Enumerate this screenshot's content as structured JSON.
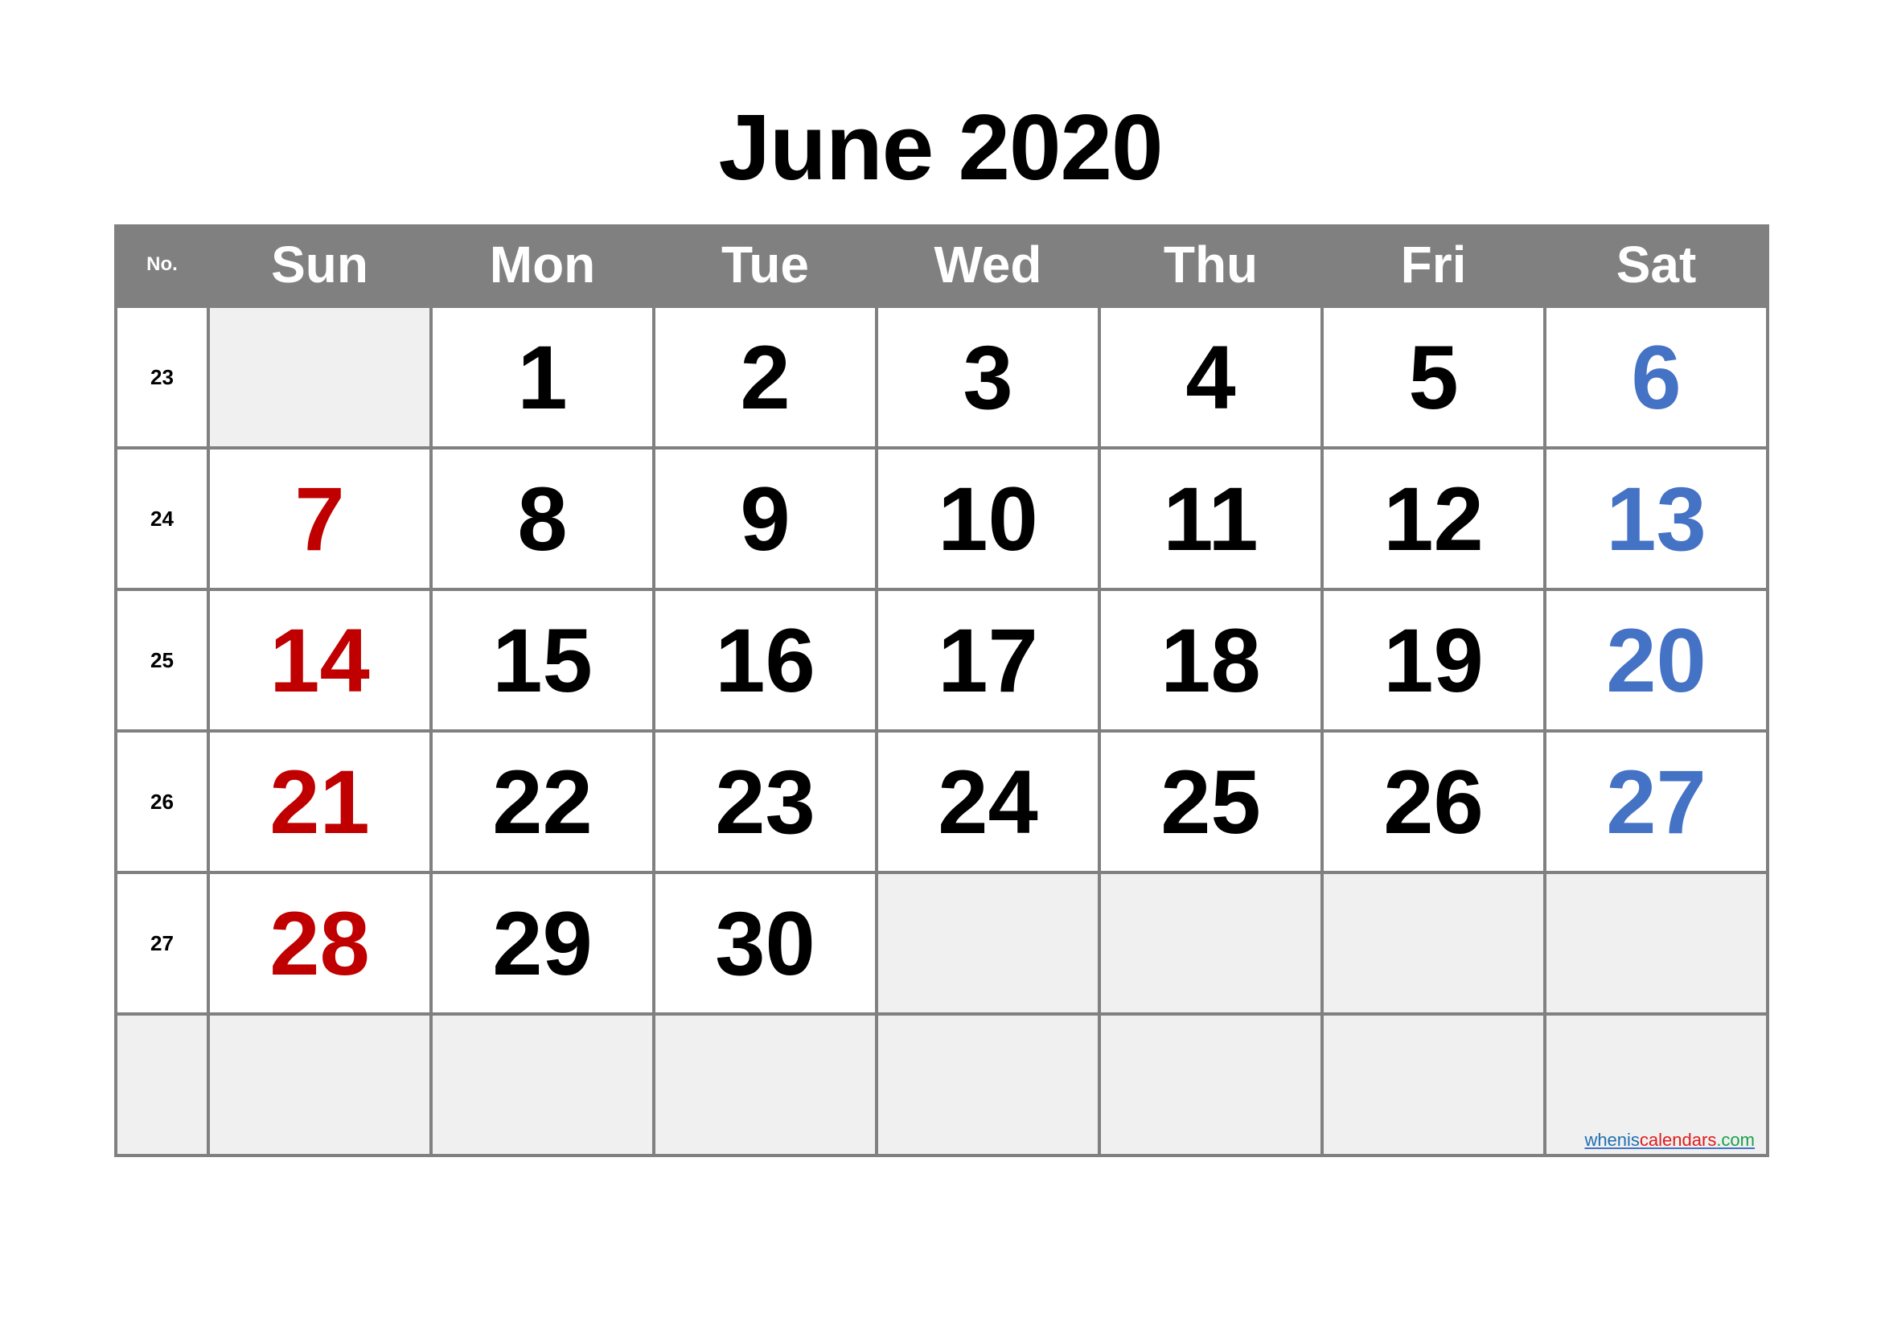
{
  "title": "June 2020",
  "header": {
    "week_no_label": "No.",
    "days": [
      "Sun",
      "Mon",
      "Tue",
      "Wed",
      "Thu",
      "Fri",
      "Sat"
    ]
  },
  "colors": {
    "header_bg": "#808080",
    "sunday": "#c00000",
    "saturday": "#4472c4",
    "empty_cell": "#f0f0f0"
  },
  "weeks": [
    {
      "no": "23",
      "days": [
        "",
        "1",
        "2",
        "3",
        "4",
        "5",
        "6"
      ]
    },
    {
      "no": "24",
      "days": [
        "7",
        "8",
        "9",
        "10",
        "11",
        "12",
        "13"
      ]
    },
    {
      "no": "25",
      "days": [
        "14",
        "15",
        "16",
        "17",
        "18",
        "19",
        "20"
      ]
    },
    {
      "no": "26",
      "days": [
        "21",
        "22",
        "23",
        "24",
        "25",
        "26",
        "27"
      ]
    },
    {
      "no": "27",
      "days": [
        "28",
        "29",
        "30",
        "",
        "",
        "",
        ""
      ]
    },
    {
      "no": "",
      "days": [
        "",
        "",
        "",
        "",
        "",
        "",
        ""
      ]
    }
  ],
  "watermark": {
    "part1": "whenis",
    "part2": "calendars",
    "part3": ".com"
  }
}
